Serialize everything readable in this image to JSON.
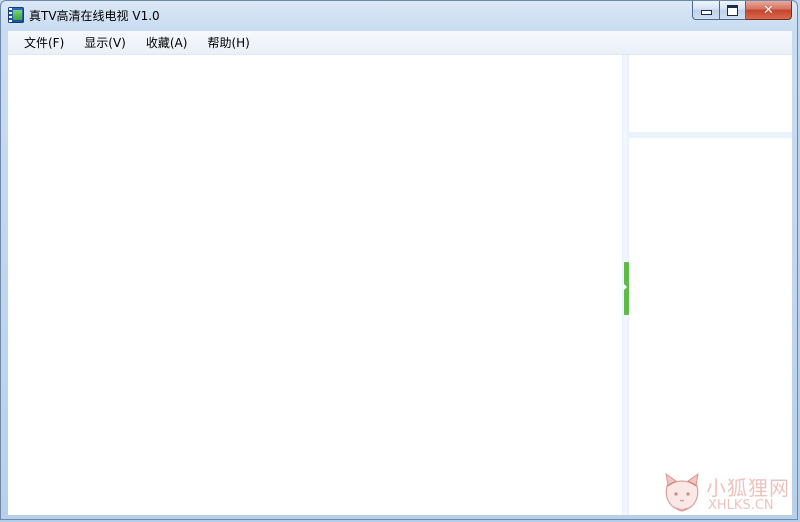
{
  "window": {
    "title": "真TV高清在线电视 V1.0",
    "icon": "tv-film-app-icon",
    "controls": {
      "minimize_icon": "minimize-icon",
      "maximize_icon": "maximize-icon",
      "close_glyph": "✕"
    }
  },
  "menubar": {
    "items": [
      {
        "label": "文件(F)"
      },
      {
        "label": "显示(V)"
      },
      {
        "label": "收藏(A)"
      },
      {
        "label": "帮助(H)"
      }
    ]
  },
  "splitter": {
    "handle_color": "#5dbb46"
  },
  "watermark": {
    "name": "小狐狸网",
    "url": "XHLKS.CN",
    "icon": "fox-icon"
  },
  "colors": {
    "titlebar": "#c9dcf1",
    "close_button": "#c7432c",
    "menubar": "#eaf0f8",
    "client_background": "#ffffff",
    "panel_divider": "#eaf2fb"
  }
}
